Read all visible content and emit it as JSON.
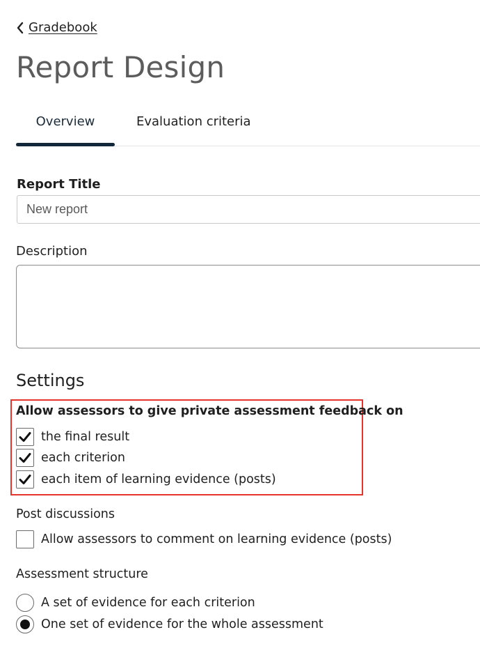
{
  "breadcrumb": {
    "back_label": "Gradebook"
  },
  "page": {
    "title": "Report Design"
  },
  "tabs": [
    {
      "label": "Overview",
      "active": true
    },
    {
      "label": "Evaluation criteria",
      "active": false
    }
  ],
  "form": {
    "report_title_label": "Report Title",
    "report_title_value": "New report",
    "description_label": "Description",
    "description_value": ""
  },
  "settings": {
    "heading": "Settings",
    "private_feedback": {
      "label": "Allow assessors to give private assessment feedback on",
      "options": [
        {
          "label": "the final result",
          "checked": true
        },
        {
          "label": "each criterion",
          "checked": true
        },
        {
          "label": "each item of learning evidence (posts)",
          "checked": true
        }
      ]
    },
    "post_discussions": {
      "label": "Post discussions",
      "options": [
        {
          "label": "Allow assessors to comment on learning evidence (posts)",
          "checked": false
        }
      ]
    },
    "assessment_structure": {
      "label": "Assessment structure",
      "options": [
        {
          "label": "A set of evidence for each criterion",
          "selected": false
        },
        {
          "label": "One set of evidence for the whole assessment",
          "selected": true
        }
      ]
    }
  },
  "colors": {
    "highlight_border": "#e5352b",
    "tab_underline": "#13273a",
    "title_text": "#5c5c5c"
  }
}
